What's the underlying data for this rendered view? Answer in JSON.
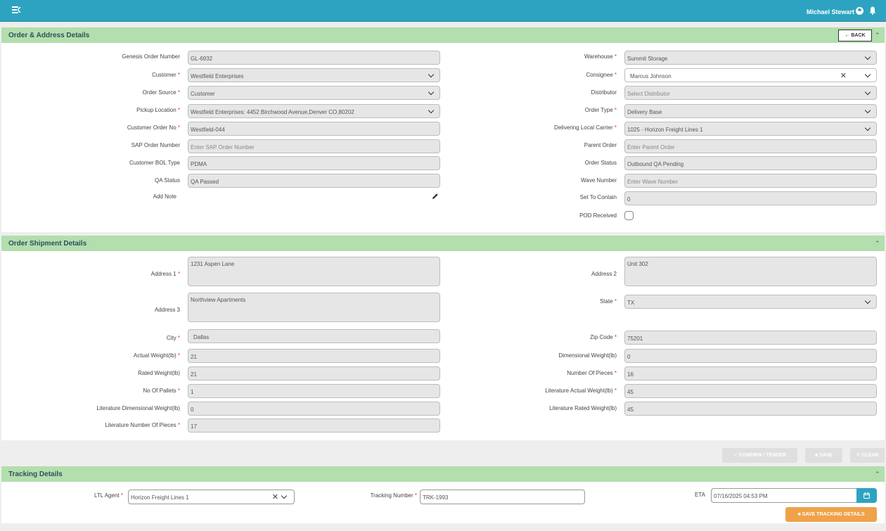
{
  "header": {
    "user_name": "Michael Stewart"
  },
  "order_section": {
    "title": "Order & Address Details",
    "back_label": "BACK",
    "genesis_order_number": {
      "label": "Genesis Order Number",
      "value": "GL-6932"
    },
    "customer": {
      "label": "Customer",
      "value": "Westfield Enterprises"
    },
    "order_source": {
      "label": "Order Source",
      "value": "Customer"
    },
    "pickup_location": {
      "label": "Pickup Location",
      "value": "Westfield Enterprises: 4452 Birchwood Avenue,Denver CO,80202"
    },
    "customer_order_no": {
      "label": "Customer Order No",
      "value": "Westfield-044"
    },
    "sap_order_number": {
      "label": "SAP Order Number",
      "placeholder": "Enter SAP Order Number"
    },
    "customer_bol_type": {
      "label": "Customer BOL Type",
      "value": "PDMA"
    },
    "qa_status": {
      "label": "QA Status",
      "value": "QA Passed"
    },
    "add_note": {
      "label": "Add Note"
    },
    "warehouse": {
      "label": "Warehouse",
      "value": "Summit Storage"
    },
    "consignee": {
      "label": "Consignee",
      "value": "Marcus Johnson"
    },
    "distributor": {
      "label": "Distributor",
      "placeholder": "Select Distributor"
    },
    "order_type": {
      "label": "Order Type",
      "value": "Delivery Base"
    },
    "delivering_local_carrier": {
      "label": "Delivering Local Carrier",
      "value": "1025 - Horizon Freight Lines 1"
    },
    "parent_order": {
      "label": "Parent Order",
      "placeholder": "Enter Parent Order"
    },
    "order_status": {
      "label": "Order Status",
      "value": "Outbound QA Pending"
    },
    "wave_number": {
      "label": "Wave Number",
      "placeholder": "Enter Wave Number"
    },
    "set_to_contain": {
      "label": "Set To Contain",
      "value": "0"
    },
    "pod_received": {
      "label": "POD Received",
      "checked": false
    }
  },
  "shipment_section": {
    "title": "Order Shipment Details",
    "address1": {
      "label": "Address 1",
      "value": "1231 Aspen Lane"
    },
    "address2": {
      "label": "Address 2",
      "value": "Unit 302"
    },
    "address3": {
      "label": "Address 3",
      "value": "Northview Apartments"
    },
    "state": {
      "label": "State",
      "value": "TX"
    },
    "city": {
      "label": "City",
      "value": "Dallas"
    },
    "zip_code": {
      "label": "Zip Code",
      "value": "75201"
    },
    "actual_weight": {
      "label": "Actual Weight(lb)",
      "value": "21"
    },
    "dimensional_weight": {
      "label": "Dimensional Weight(lb)",
      "value": "0"
    },
    "rated_weight": {
      "label": "Rated Weight(lb)",
      "value": "21"
    },
    "number_of_pieces": {
      "label": "Number Of Pieces",
      "value": "16"
    },
    "no_of_pallets": {
      "label": "No Of Pallets",
      "value": "1"
    },
    "literature_actual_weight": {
      "label": "Literature Actual Weight(lb)",
      "value": "45"
    },
    "literature_dimensional_weight": {
      "label": "Literature Dimensional Weight(lb)",
      "value": "0"
    },
    "literature_rated_weight": {
      "label": "Literature Rated Weight(lb)",
      "value": "45"
    },
    "literature_number_of_pieces": {
      "label": "Literature Number Of Pieces",
      "value": "17"
    }
  },
  "actions": {
    "confirm_label": "CONFIRM / TENDER",
    "save_label": "SAVE",
    "clear_label": "CLEAR"
  },
  "tracking_section": {
    "title": "Tracking Details",
    "ltl_agent": {
      "label": "LTL Agent",
      "value": "Horizon Freight Lines 1"
    },
    "tracking_number": {
      "label": "Tracking Number",
      "value": "TRK-1993"
    },
    "eta": {
      "label": "ETA",
      "value": "07/16/2025 04:53 PM"
    },
    "save_tracking_label": "SAVE TRACKING DETAILS"
  },
  "colors": {
    "header": "#2ea3c1",
    "section_header": "#b2dfad",
    "accent_orange": "#f0a24a",
    "required": "#e53935"
  }
}
